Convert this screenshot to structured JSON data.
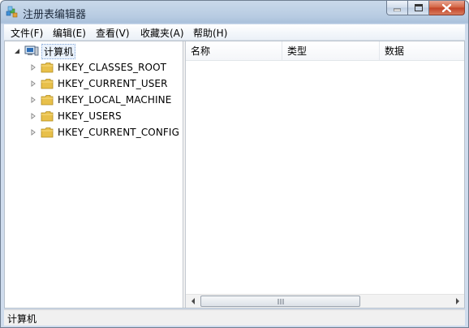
{
  "window": {
    "title": "注册表编辑器"
  },
  "menu": [
    "文件(F)",
    "编辑(E)",
    "查看(V)",
    "收藏夹(A)",
    "帮助(H)"
  ],
  "tree": {
    "root": {
      "label": "计算机",
      "icon": "computer-icon",
      "expanded": true
    },
    "children": [
      {
        "label": "HKEY_CLASSES_ROOT",
        "icon": "folder-icon"
      },
      {
        "label": "HKEY_CURRENT_USER",
        "icon": "folder-icon"
      },
      {
        "label": "HKEY_LOCAL_MACHINE",
        "icon": "folder-icon"
      },
      {
        "label": "HKEY_USERS",
        "icon": "folder-icon"
      },
      {
        "label": "HKEY_CURRENT_CONFIG",
        "icon": "folder-icon"
      }
    ]
  },
  "list": {
    "columns": [
      "名称",
      "类型",
      "数据"
    ]
  },
  "status": {
    "path": "计算机"
  },
  "colors": {
    "folder": "#e8c04a",
    "close_button": "#c9452a",
    "selection_outline": "#7fa4d6"
  }
}
